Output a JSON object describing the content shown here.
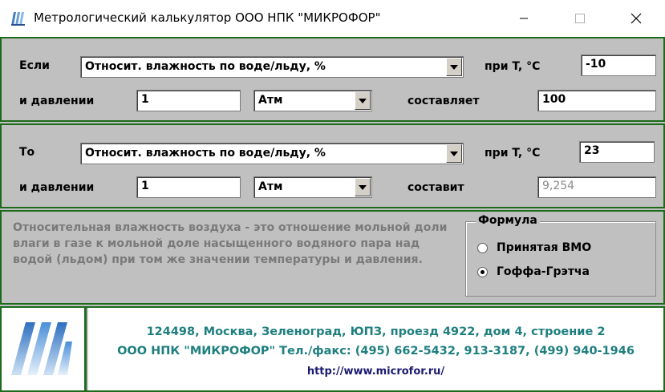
{
  "window": {
    "title": "Метрологический калькулятор ООО НПК \"МИКРОФОР\""
  },
  "from_section": {
    "if_label": "Если",
    "quantity": "Относит. влажность по воде/льду, %",
    "temp_label": "при T, °C",
    "temp_value": "-10",
    "pressure_label": "и давлении",
    "pressure_value": "1",
    "pressure_unit": "Атм",
    "result_label": "составляет",
    "result_value": "100"
  },
  "to_section": {
    "to_label": "То",
    "quantity": "Относит. влажность по воде/льду, %",
    "temp_label": "при T, °C",
    "temp_value": "23",
    "pressure_label": "и давлении",
    "pressure_value": "1",
    "pressure_unit": "Атм",
    "result_label": "составит",
    "result_value": "9,254"
  },
  "description": "Относительная влажность воздуха - это отношение мольной доли влаги в газе к мольной доле насыщенного водяного пара над водой (льдом) при том же значении температуры и давления.",
  "formula": {
    "title": "Формула",
    "options": [
      {
        "label": "Принятая ВМО",
        "checked": false
      },
      {
        "label": "Гоффа-Грэтча",
        "checked": true
      }
    ]
  },
  "contact": {
    "address": "124498, Москва, Зеленоград, ЮПЗ, проезд 4922, дом 4, строение 2",
    "company_phone": "ООО НПК \"МИКРОФОР\" Тел./факс: (495) 662-5432, 913-3187, (499) 940-1946",
    "url": "http://www.microfor.ru/"
  },
  "colors": {
    "panel_bg": "#c0c0c0",
    "border_green": "#1c6b1c",
    "contact_text": "#1f7f7f",
    "url_text": "#1a1a70",
    "logo_blue": "#5aa0d8"
  }
}
